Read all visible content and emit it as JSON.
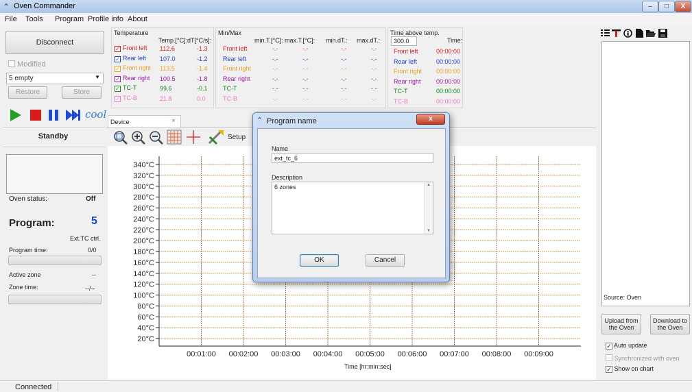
{
  "window": {
    "title": "Oven Commander",
    "min": "–",
    "max": "□",
    "close": "X"
  },
  "menu": [
    "File",
    "Tools",
    "Program",
    "Profile info",
    "About"
  ],
  "left": {
    "disconnect": "Disconnect",
    "modified": "Modified",
    "profile_select": "5 empty",
    "restore": "Restore",
    "store": "Store",
    "cool": "cool",
    "state": "Standby",
    "oven_status_label": "Oven status:",
    "oven_status_value": "Off",
    "program_label": "Program:",
    "program_value": "5",
    "ctrl": "Ext.TC ctrl.",
    "program_time_label": "Program time:",
    "program_time_value": "0/0",
    "active_zone_label": "Active zone",
    "active_zone_value": "--",
    "zone_time_label": "Zone time:",
    "zone_time_value": "--/--"
  },
  "temperature": {
    "title": "Temperature",
    "col_temp": "Temp.[°C]:",
    "col_dt": "dT[°C/s]:",
    "rows": [
      {
        "name": "Front left",
        "temp": "112.6",
        "dt": "-1.3",
        "color": "#e11d1d"
      },
      {
        "name": "Rear left",
        "temp": "107.0",
        "dt": "-1.2",
        "color": "#1d3fd6"
      },
      {
        "name": "Front right",
        "temp": "113.5",
        "dt": "-1.4",
        "color": "#f0a020"
      },
      {
        "name": "Rear right",
        "temp": "100.5",
        "dt": "-1.8",
        "color": "#a01aa0"
      },
      {
        "name": "TC-T",
        "temp": "99.6",
        "dt": "-0.1",
        "color": "#178a17"
      },
      {
        "name": "TC-B",
        "temp": "21.8",
        "dt": "0.0",
        "color": "#f07ac8"
      }
    ]
  },
  "minmax": {
    "title": "Min/Max",
    "cols": [
      "min.T.[°C]:",
      "max.T.[°C]:",
      "min.dT.:",
      "max.dT.:"
    ],
    "placeholder": "-.-",
    "rows": [
      "Front left",
      "Rear left",
      "Front right",
      "Rear right",
      "TC-T",
      "TC-B"
    ]
  },
  "time_above": {
    "title": "Time above temp.",
    "threshold": "300.0",
    "col_time": "Time:",
    "rows": [
      "Front left",
      "Rear left",
      "Front right",
      "Rear right",
      "TC-T",
      "TC-B"
    ],
    "value": "00:00:00"
  },
  "tab": {
    "label": "Device",
    "close": "×"
  },
  "toolbar": {
    "setup": "Setup"
  },
  "chart_data": {
    "type": "line",
    "y_ticks": [
      "340°C",
      "320°C",
      "300°C",
      "280°C",
      "260°C",
      "240°C",
      "220°C",
      "200°C",
      "180°C",
      "160°C",
      "140°C",
      "120°C",
      "100°C",
      "80°C",
      "60°C",
      "40°C",
      "20°C"
    ],
    "x_ticks": [
      "00:01:00",
      "00:02:00",
      "00:03:00",
      "00:04:00",
      "00:05:00",
      "00:06:00",
      "00:07:00",
      "00:08:00",
      "00:09:00"
    ],
    "xlabel": "Time [hr:min:sec]",
    "ylim": [
      20,
      340
    ],
    "xlim": [
      "00:00:00",
      "00:10:00"
    ],
    "grid": true,
    "series": []
  },
  "dialog": {
    "title": "Program name",
    "name_label": "Name",
    "name_value": "ext_tc_6",
    "desc_label": "Description",
    "desc_value": "6 zones",
    "ok": "OK",
    "cancel": "Cancel"
  },
  "right": {
    "source": "Source: Oven",
    "upload": "Upload from the Oven",
    "download": "Download to the Oven",
    "auto_update": "Auto update",
    "synchronized": "Synchronized with oven",
    "show_on_chart": "Show on chart"
  },
  "status": {
    "text": "Connected"
  }
}
